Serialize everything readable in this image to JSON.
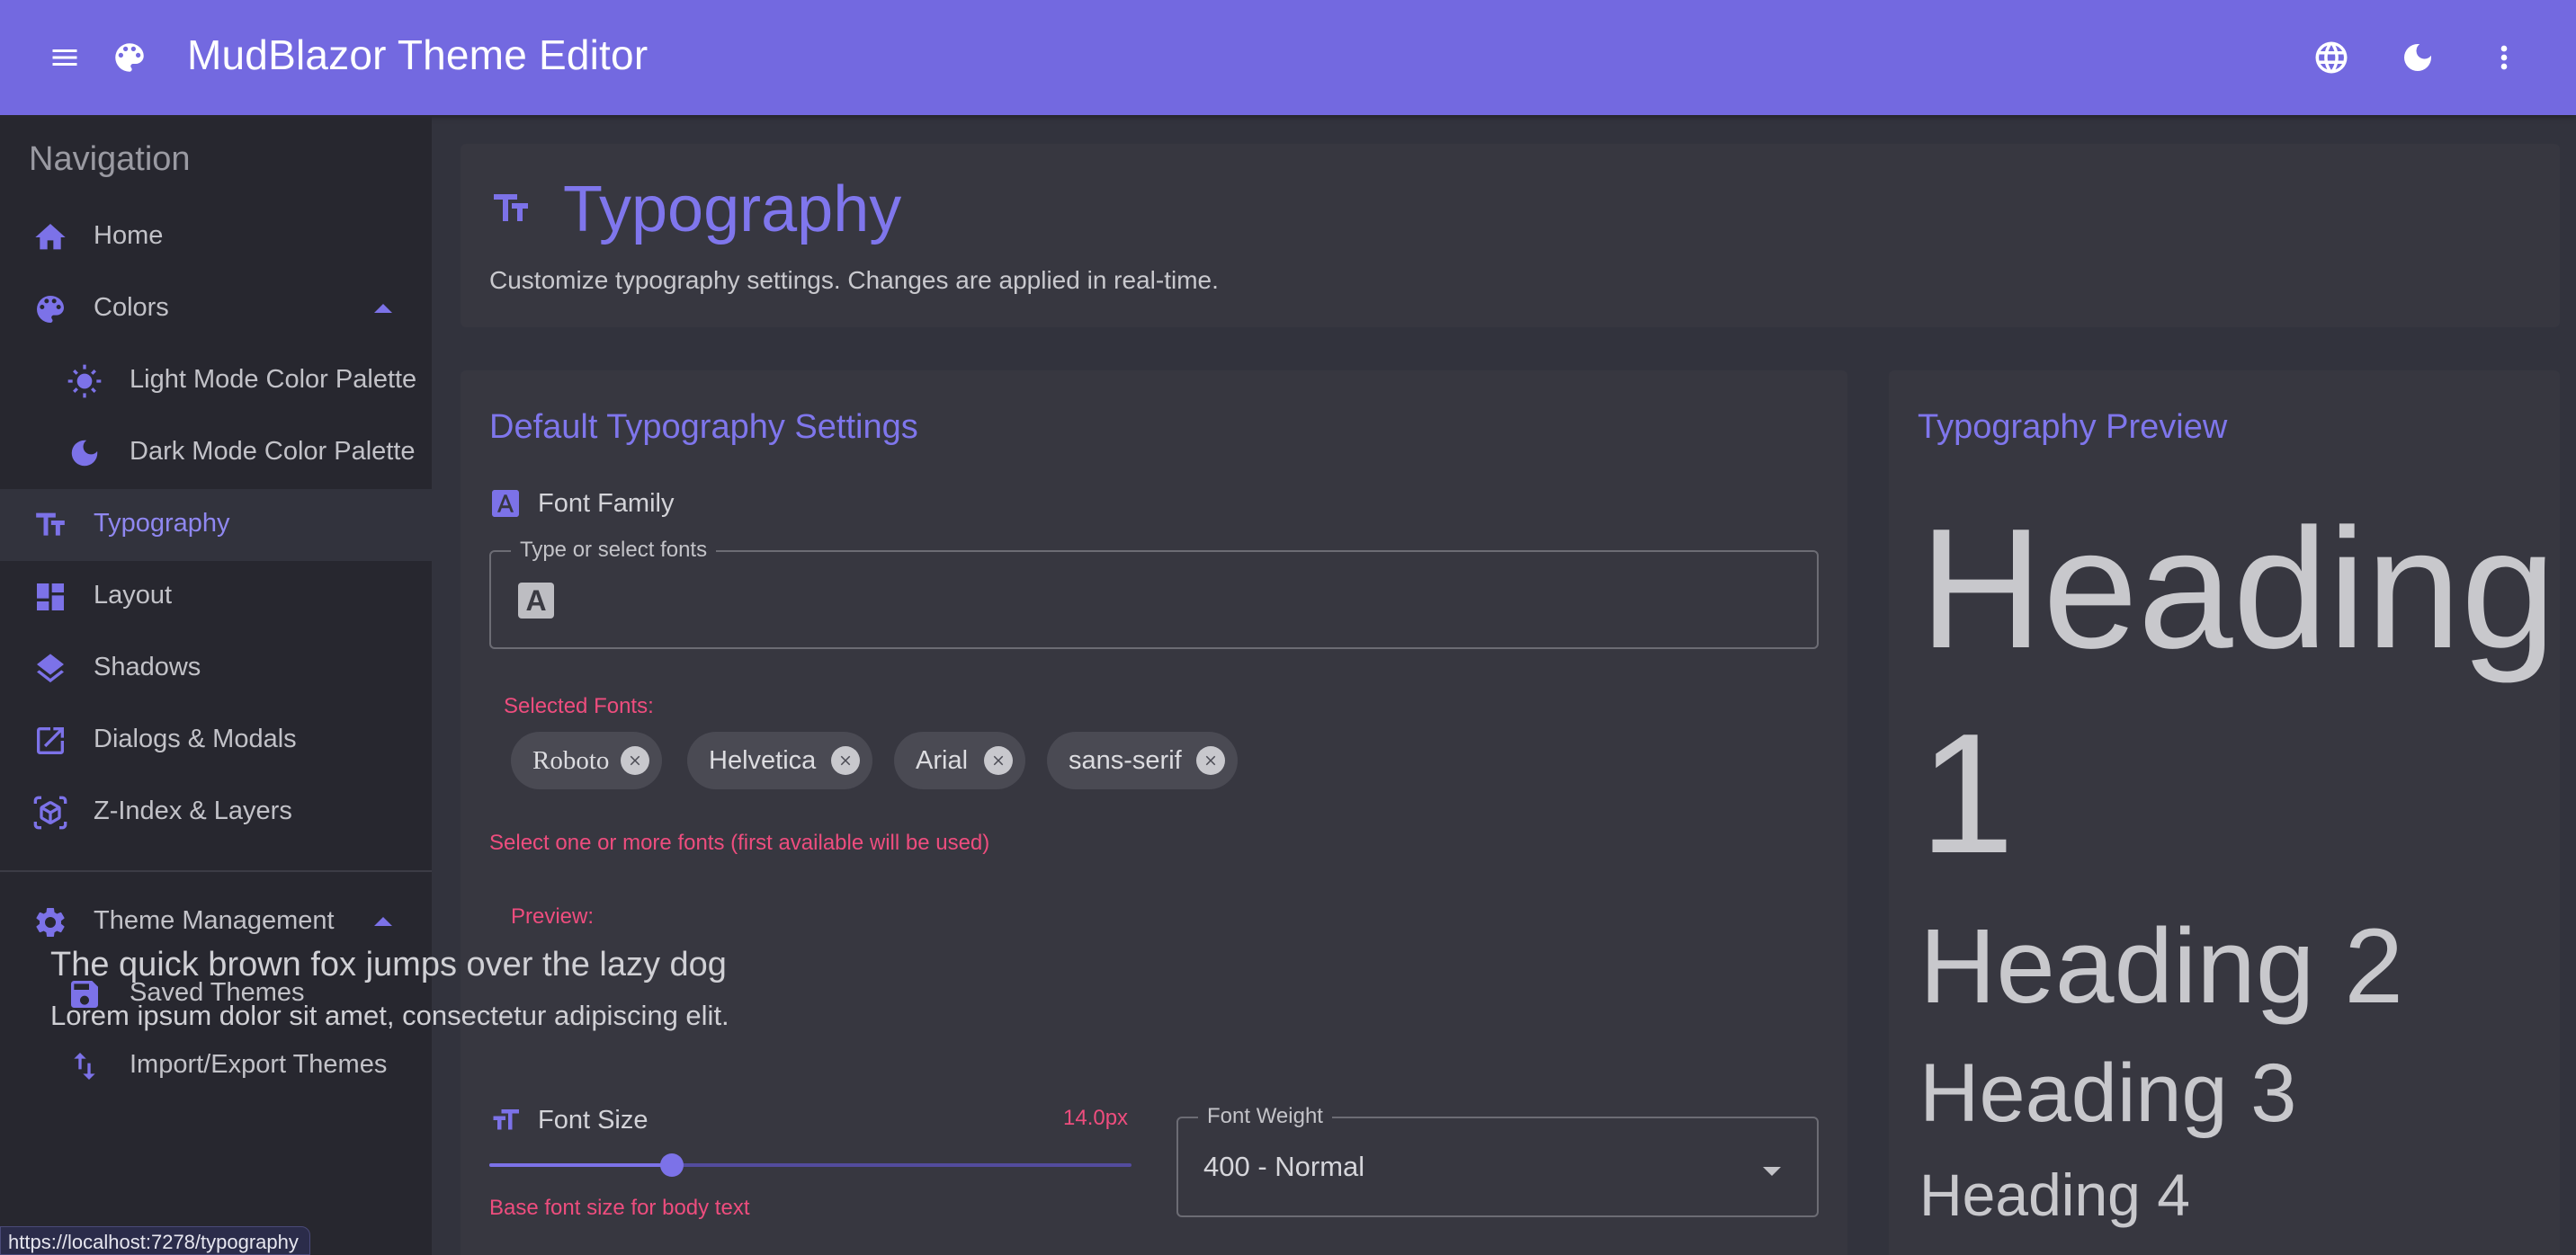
{
  "appbar": {
    "title": "MudBlazor Theme Editor",
    "icons": [
      "menu-icon",
      "palette-icon",
      "globe-icon",
      "dark-mode-icon",
      "more-vert-icon"
    ],
    "color": "#7369e0"
  },
  "sidebar": {
    "title": "Navigation",
    "items": [
      {
        "label": "Home",
        "icon": "home-icon"
      },
      {
        "label": "Colors",
        "icon": "palette-icon",
        "expanded": true
      },
      {
        "label": "Light Mode Color Palette",
        "icon": "sun-icon"
      },
      {
        "label": "Dark Mode Color Palette",
        "icon": "moon-icon"
      },
      {
        "label": "Typography",
        "icon": "text-fields-icon",
        "active": true
      },
      {
        "label": "Layout",
        "icon": "dashboard-icon"
      },
      {
        "label": "Shadows",
        "icon": "layers-icon"
      },
      {
        "label": "Dialogs & Modals",
        "icon": "open-in-new-icon"
      },
      {
        "label": "Z-Index & Layers",
        "icon": "view-in-ar-icon"
      },
      {
        "label": "Theme Management",
        "icon": "settings-icon",
        "expanded": true
      },
      {
        "label": "Saved Themes",
        "icon": "save-icon"
      },
      {
        "label": "Import/Export Themes",
        "icon": "import-export-icon"
      }
    ]
  },
  "status_url": "https://localhost:7278/typography",
  "page": {
    "title": "Typography",
    "subtitle": "Customize typography settings. Changes are applied in real-time."
  },
  "settings": {
    "title": "Default Typography Settings",
    "font_family_label": "Font Family",
    "font_input_legend": "Type or select fonts",
    "selected_label": "Selected Fonts:",
    "chips": [
      "Roboto",
      "Helvetica",
      "Arial",
      "sans-serif"
    ],
    "helper": "Select one or more fonts (first available will be used)",
    "preview_label": "Preview:",
    "preview_line1": "The quick brown fox jumps over the lazy dog",
    "preview_line2": "Lorem ipsum dolor sit amet, consectetur adipiscing elit.",
    "font_size_label": "Font Size",
    "font_size_value": "14.0px",
    "font_size_fraction": 0.285,
    "font_size_helper": "Base font size for body text",
    "font_weight_legend": "Font Weight",
    "font_weight_value": "400 - Normal"
  },
  "preview": {
    "title": "Typography Preview",
    "h1": "Heading",
    "h1_b": "1",
    "h2": "Heading 2",
    "h3": "Heading 3",
    "h4": "Heading 4"
  },
  "colors": {
    "primary": "#7c72e8",
    "error": "#ee4d7e",
    "surface": "#373740",
    "background": "#32333d",
    "drawer": "#27272f"
  }
}
